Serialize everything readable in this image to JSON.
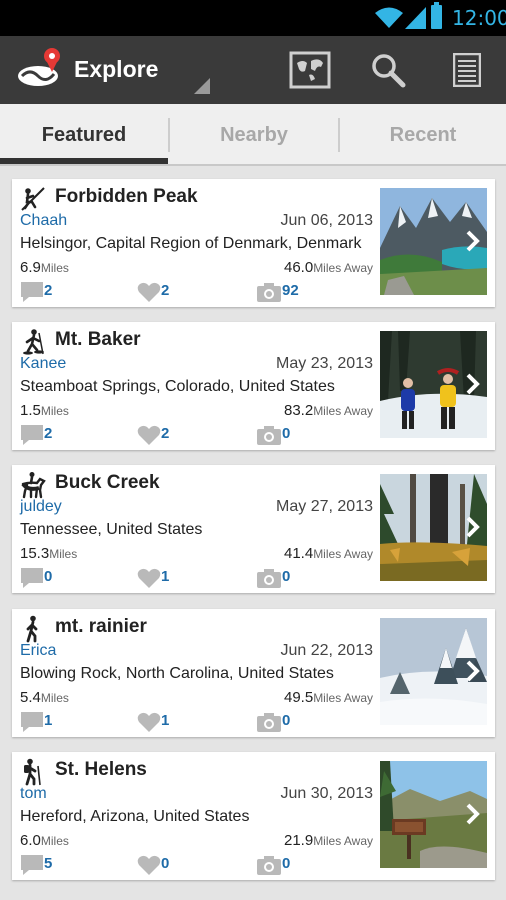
{
  "status_bar": {
    "time": "12:00",
    "icons": [
      "wifi-icon",
      "signal-icon",
      "battery-icon"
    ]
  },
  "action_bar": {
    "title": "Explore",
    "icons": [
      "app-logo-icon",
      "map-icon",
      "search-icon",
      "list-icon"
    ]
  },
  "tabs": [
    {
      "label": "Featured",
      "selected": true
    },
    {
      "label": "Nearby",
      "selected": false
    },
    {
      "label": "Recent",
      "selected": false
    }
  ],
  "trips": [
    {
      "activity_icon": "climbing-icon",
      "title": "Forbidden Peak",
      "user": "Chaah",
      "date": "Jun 06, 2013",
      "location": "Helsingor, Capital Region of Denmark, Denmark",
      "distance": "6.9",
      "distance_unit": "Miles",
      "away": "46.0",
      "away_unit": "Miles Away",
      "comments": "2",
      "likes": "2",
      "photos": "92",
      "thumb": "mountain-lake"
    },
    {
      "activity_icon": "snowshoe-icon",
      "title": "Mt. Baker",
      "user": "Kanee",
      "date": "May 23, 2013",
      "location": "Steamboat Springs, Colorado, United States",
      "distance": "1.5",
      "distance_unit": "Miles",
      "away": "83.2",
      "away_unit": "Miles Away",
      "comments": "2",
      "likes": "2",
      "photos": "0",
      "thumb": "snow-hikers"
    },
    {
      "activity_icon": "horse-icon",
      "title": "Buck Creek",
      "user": "juldey",
      "date": "May 27, 2013",
      "location": "Tennessee, United States",
      "distance": "15.3",
      "distance_unit": "Miles",
      "away": "41.4",
      "away_unit": "Miles Away",
      "comments": "0",
      "likes": "1",
      "photos": "0",
      "thumb": "forest-autumn"
    },
    {
      "activity_icon": "walking-icon",
      "title": "mt. rainier",
      "user": "Erica",
      "date": "Jun 22, 2013",
      "location": "Blowing Rock, North Carolina, United States",
      "distance": "5.4",
      "distance_unit": "Miles",
      "away": "49.5",
      "away_unit": "Miles Away",
      "comments": "1",
      "likes": "1",
      "photos": "0",
      "thumb": "snowy-trees"
    },
    {
      "activity_icon": "hiking-icon",
      "title": "St. Helens",
      "user": "tom",
      "date": "Jun 30, 2013",
      "location": "Hereford, Arizona, United States",
      "distance": "6.0",
      "distance_unit": "Miles",
      "away": "21.9",
      "away_unit": "Miles Away",
      "comments": "5",
      "likes": "0",
      "photos": "0",
      "thumb": "trail-sign"
    }
  ],
  "colors": {
    "link": "#1e6ba8",
    "action_bar": "#3a3a3a",
    "accent": "#33b5e5"
  }
}
